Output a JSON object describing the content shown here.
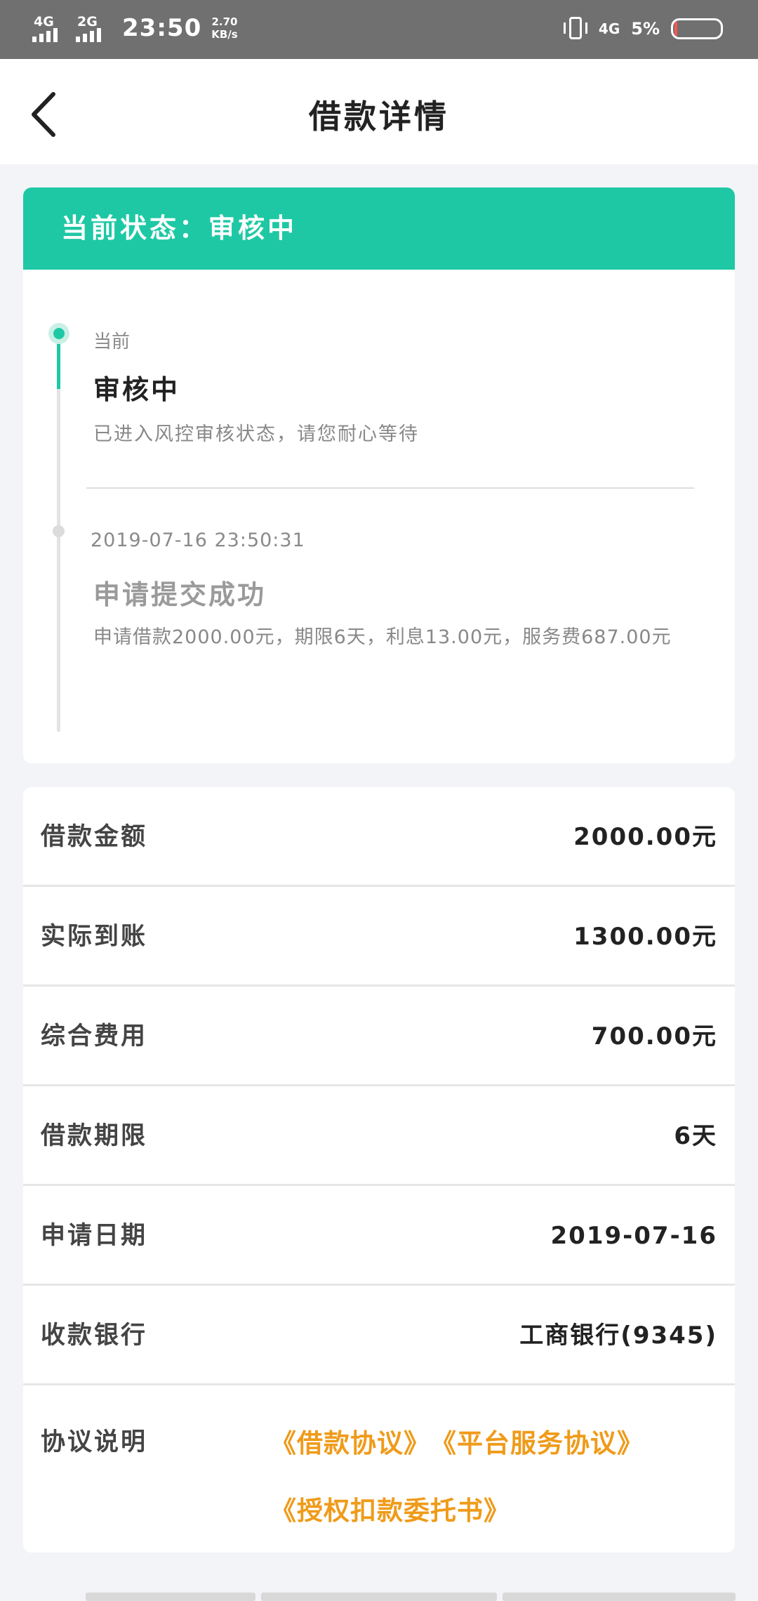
{
  "status_bar": {
    "sim1": "4G",
    "sim2": "2G",
    "time": "23:50",
    "speed_value": "2.70",
    "speed_unit": "KB/s",
    "net_right": "4G",
    "battery": "5%",
    "battery_level": 0.05,
    "icons": [
      "signal-icon",
      "vibrate-icon",
      "battery-icon"
    ]
  },
  "nav": {
    "title": "借款详情",
    "back_icon": "chevron-left-icon"
  },
  "status_card": {
    "header": "当前状态：审核中",
    "accent_color": "#1ec8a4",
    "timeline": [
      {
        "label": "当前",
        "title": "审核中",
        "desc": "已进入风控审核状态，请您耐心等待",
        "active": true
      },
      {
        "time": "2019-07-16 23:50:31",
        "title": "申请提交成功",
        "desc": "申请借款2000.00元，期限6天，利息13.00元，服务费687.00元",
        "active": false
      }
    ]
  },
  "details": {
    "rows": [
      {
        "label": "借款金额",
        "value": "2000.00元"
      },
      {
        "label": "实际到账",
        "value": "1300.00元"
      },
      {
        "label": "综合费用",
        "value": "700.00元"
      },
      {
        "label": "借款期限",
        "value": "6天"
      },
      {
        "label": "申请日期",
        "value": "2019-07-16"
      },
      {
        "label": "收款银行",
        "value": "工商银行(9345)"
      }
    ],
    "agreement": {
      "label": "协议说明",
      "link_color": "#ef9b1a",
      "links": [
        "《借款协议》",
        "《平台服务协议》",
        "《授权扣款委托书》"
      ]
    }
  }
}
